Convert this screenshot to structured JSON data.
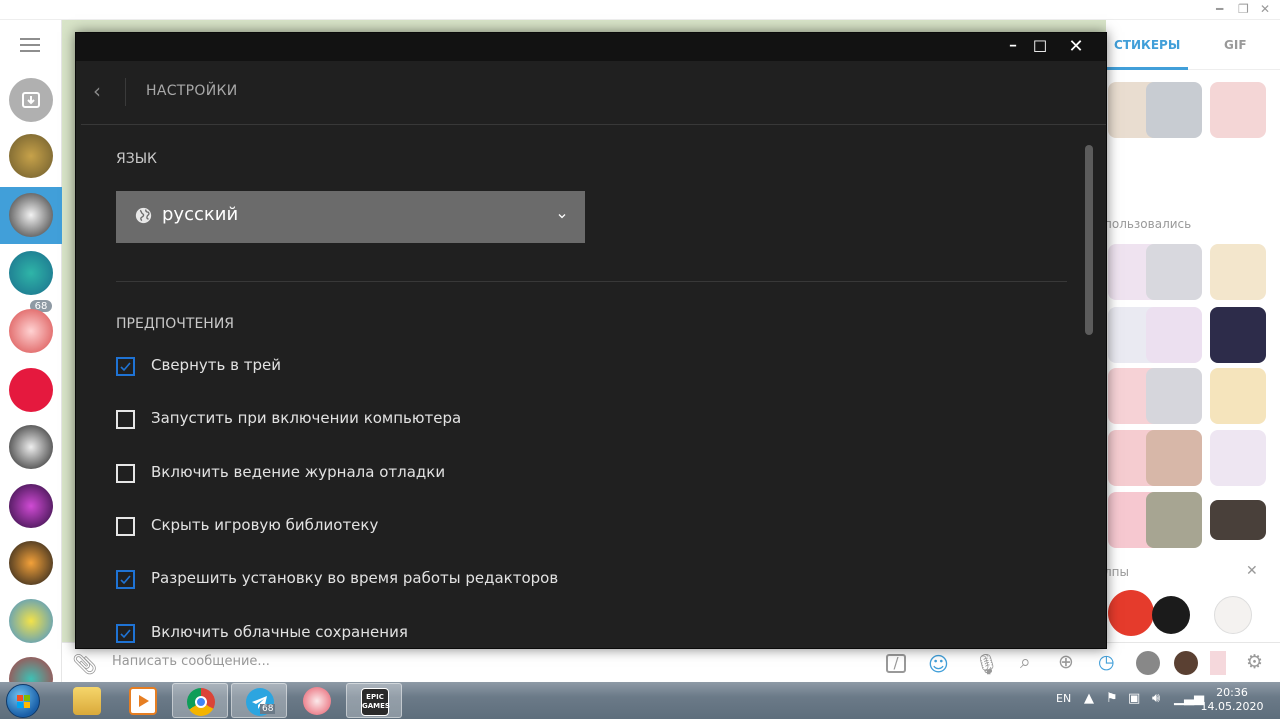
{
  "telegram": {
    "sidebar_badge": "68",
    "input_placeholder": "Написать сообщение...",
    "panel_tabs": {
      "stickers": "СТИКЕРЫ",
      "gif": "GIF"
    },
    "recent_section": "пользовались",
    "bottom_section": "лпы",
    "bottom_close": "✕",
    "colors": {
      "accent": "#419fd9"
    }
  },
  "epic": {
    "window_controls": {
      "minimize": "━",
      "maximize": "☐",
      "close": "✕"
    },
    "header": {
      "back": "‹",
      "title": "НАСТРОЙКИ"
    },
    "language": {
      "label": "ЯЗЫК",
      "selected": "русский"
    },
    "preferences": {
      "label": "ПРЕДПОЧТЕНИЯ",
      "items": [
        {
          "label": "Свернуть в трей",
          "checked": true
        },
        {
          "label": "Запустить при включении компьютера",
          "checked": false
        },
        {
          "label": "Включить ведение журнала отладки",
          "checked": false
        },
        {
          "label": "Скрыть игровую библиотеку",
          "checked": false
        },
        {
          "label": "Разрешить установку во время работы редакторов",
          "checked": true
        },
        {
          "label": "Включить облачные сохранения",
          "checked": true
        }
      ]
    },
    "colors": {
      "background": "#202020",
      "checkbox_checked": "#1f73d4",
      "select_bg": "#6b6b6b"
    }
  },
  "taskbar": {
    "apps": [
      "windows-explorer",
      "media-player",
      "chrome",
      "telegram",
      "snipping-tool",
      "epic-games"
    ],
    "telegram_badge": "68",
    "epic_label": "EPIC GAMES",
    "tray_language": "EN",
    "time": "20:36",
    "date": "14.05.2020"
  }
}
